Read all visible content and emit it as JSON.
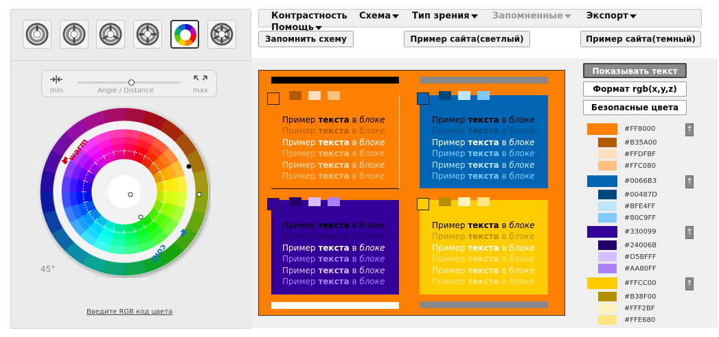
{
  "menu": {
    "items": [
      {
        "label": "Контрастность",
        "has_dropdown": false,
        "disabled": false
      },
      {
        "label": "Схема",
        "has_dropdown": true,
        "disabled": false
      },
      {
        "label": "Тип зрения",
        "has_dropdown": true,
        "disabled": false
      },
      {
        "label": "Запомненные",
        "has_dropdown": true,
        "disabled": true
      },
      {
        "label": "Экспорт",
        "has_dropdown": true,
        "disabled": false
      },
      {
        "label": "Помощь",
        "has_dropdown": true,
        "disabled": false
      }
    ]
  },
  "toolbar": {
    "save_scheme": "Запомнить схему",
    "light_site": "Пример сайта(светлый)",
    "dark_site": "Пример сайта(темный)"
  },
  "scheme_types": {
    "active_index": 4,
    "count": 6
  },
  "slider": {
    "min_label": "min",
    "max_label": "max",
    "caption": "Angle / Distance",
    "value_fraction": 0.52
  },
  "wheel": {
    "warm_label": "warm",
    "cold_label": "cold",
    "angle_label": "45°"
  },
  "rgb_link": "Введите RGB код цвета",
  "right": {
    "show_text": "Показывать текст",
    "rgb_format": "Формат rgb(x,y,z)",
    "safe_colors": "Безопасные цвета"
  },
  "sample_text": {
    "word1": "Пример",
    "word2": "текста",
    "word3": "в",
    "word4": "блоке"
  },
  "palette": [
    {
      "base": "#FF8000",
      "shades": [
        "#B35A00",
        "#FFDFBF",
        "#FFC080"
      ]
    },
    {
      "base": "#0066B3",
      "shades": [
        "#00487D",
        "#BFE4FF",
        "#80C9FF"
      ]
    },
    {
      "base": "#330099",
      "shades": [
        "#24006B",
        "#D5BFFF",
        "#AA80FF"
      ]
    },
    {
      "base": "#FFCC00",
      "shades": [
        "#B38F00",
        "#FFF2BF",
        "#FFE680"
      ]
    }
  ],
  "colors": {
    "ui_gray": "#efefef",
    "border": "#c8c8c8",
    "text_black": "#000000",
    "text_white": "#ffffff",
    "bar_black": "#000000",
    "bar_gray": "#888888"
  }
}
